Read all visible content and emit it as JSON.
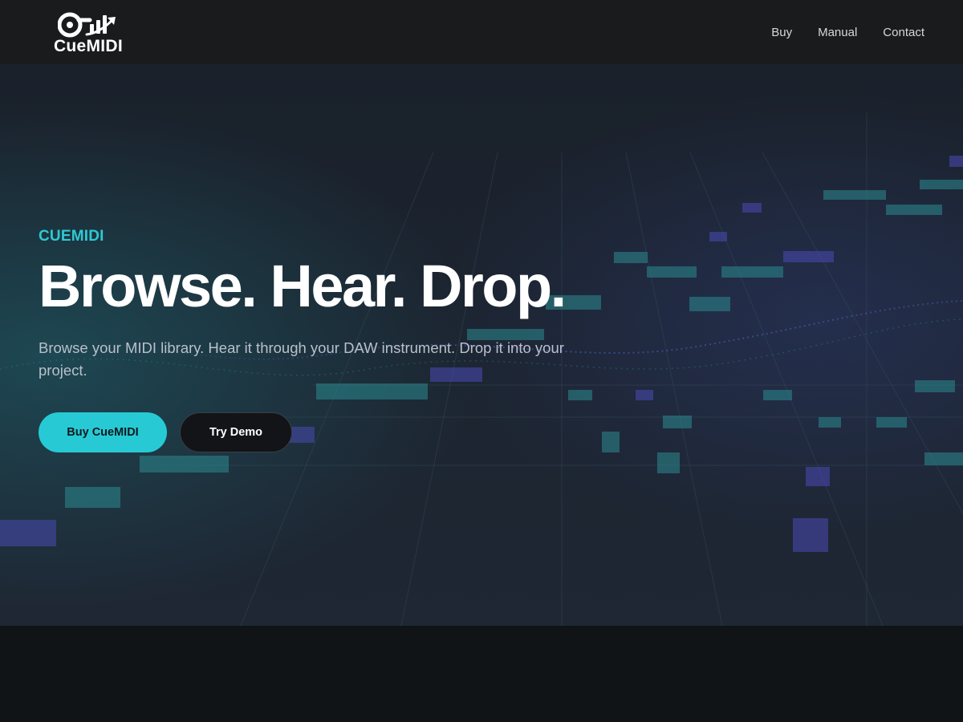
{
  "header": {
    "logo_text": "CueMIDI",
    "nav": [
      {
        "label": "Buy"
      },
      {
        "label": "Manual"
      },
      {
        "label": "Contact"
      }
    ]
  },
  "hero": {
    "eyebrow": "CUEMIDI",
    "headline": "Browse. Hear. Drop.",
    "subtext": "Browse your MIDI library. Hear it through your DAW instrument. Drop it into your project.",
    "primary_cta": "Buy CueMIDI",
    "secondary_cta": "Try Demo"
  },
  "colors": {
    "accent": "#27cad4",
    "header_bg": "#1a1b1d",
    "hero_bg": "#1c2430",
    "page_bg": "#101316"
  },
  "icons": {
    "logo": "cue-loop-bars-arrow-icon"
  }
}
